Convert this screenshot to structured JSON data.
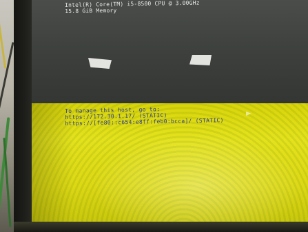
{
  "console": {
    "cpu_line": "Intel(R) Core(TM) i5-8500 CPU @ 3.00GHz",
    "memory_line": "15.8 GiB Memory",
    "manage_line": "To manage this host, go to:",
    "url_ipv4": "https://172.30.1.17/ (STATIC)",
    "url_ipv6": "https://[fe80::c654:e8ff:feb0:bcca]/ (STATIC)"
  },
  "colors": {
    "screen_top": "#3c3f3c",
    "screen_bottom": "#dcd814",
    "text_light": "#e8ece8",
    "text_blue": "#2d3a8c"
  }
}
